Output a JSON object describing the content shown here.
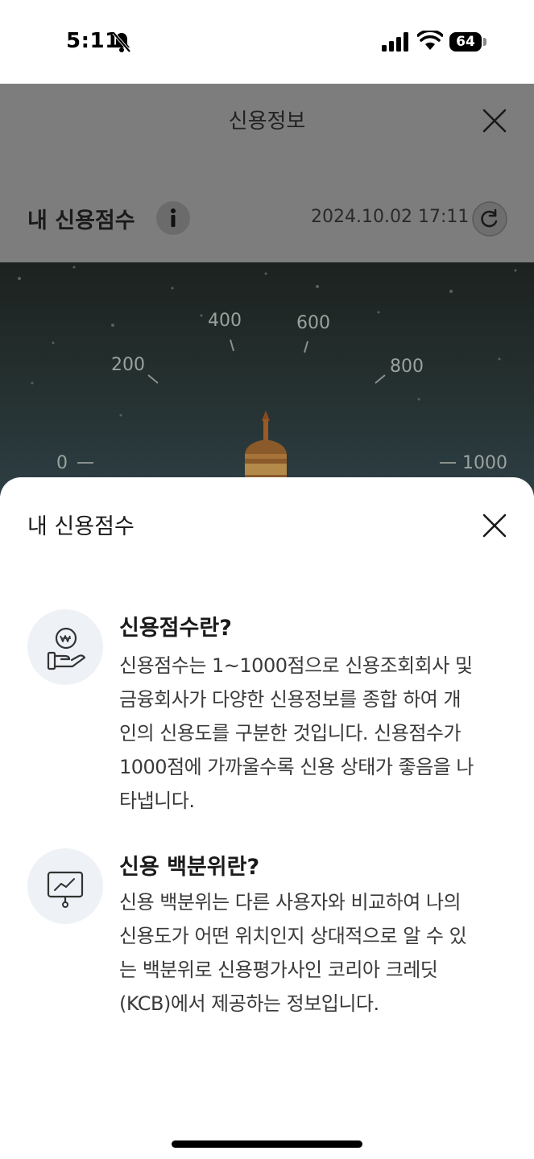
{
  "status_bar": {
    "time": "5:11",
    "battery": "64"
  },
  "background": {
    "title": "신용정보",
    "score_label": "내 신용점수",
    "datetime": "2024.10.02 17:11",
    "gauge_ticks": [
      "0",
      "200",
      "400",
      "600",
      "800",
      "1000"
    ]
  },
  "sheet": {
    "title": "내 신용점수",
    "sections": [
      {
        "icon": "hand-coin-icon",
        "title": "신용점수란?",
        "body_lines": [
          "신용점수는 1~1000점으로 신용조회회사 및",
          "금융회사가 다양한 신용정보를 종합 하여 개",
          "인의 신용도를 구분한 것입니다. 신용점수가",
          "1000점에 가까울수록 신용 상태가 좋음을 나",
          "타냅니다."
        ]
      },
      {
        "icon": "presentation-chart-icon",
        "title": "신용 백분위란?",
        "body_lines": [
          "신용 백분위는 다른 사용자와 비교하여 나의",
          "신용도가 어떤 위치인지 상대적으로 알 수 있",
          "는 백분위로 신용평가사인 코리아 크레딧",
          "(KCB)에서 제공하는 정보입니다."
        ]
      }
    ]
  }
}
